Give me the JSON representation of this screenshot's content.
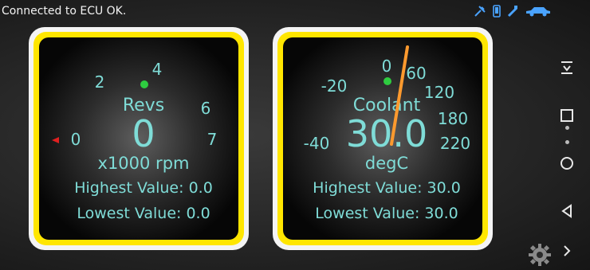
{
  "status": {
    "message": "Connected to ECU OK.",
    "icons": [
      "gps-icon",
      "phone-icon",
      "bluetooth-icon",
      "car-icon"
    ]
  },
  "gauges": [
    {
      "title": "Revs",
      "value": "0",
      "unit": "x1000 rpm",
      "ticks": [
        "0",
        "2",
        "4",
        "6",
        "7"
      ],
      "highest": "Highest Value: 0.0",
      "lowest": "Lowest Value: 0.0"
    },
    {
      "title": "Coolant",
      "value": "30.0",
      "unit": "degC",
      "ticks": [
        "-40",
        "-20",
        "0",
        "60",
        "120",
        "180",
        "220"
      ],
      "highest": "Highest Value: 30.0",
      "lowest": "Lowest Value: 30.0"
    }
  ],
  "navigation": {
    "icons": [
      "dropdown-menu-icon",
      "recents-square-icon",
      "home-circle-icon",
      "back-triangle-icon",
      "next-arrow-icon"
    ]
  },
  "settings_icon": "gear-icon",
  "colors": {
    "gauge_text": "#7fdcd7",
    "frame_yellow": "#ffe600",
    "needle_orange": "#ff9a2e",
    "marker_green": "#2ecc40",
    "marker_red": "#e02020"
  }
}
